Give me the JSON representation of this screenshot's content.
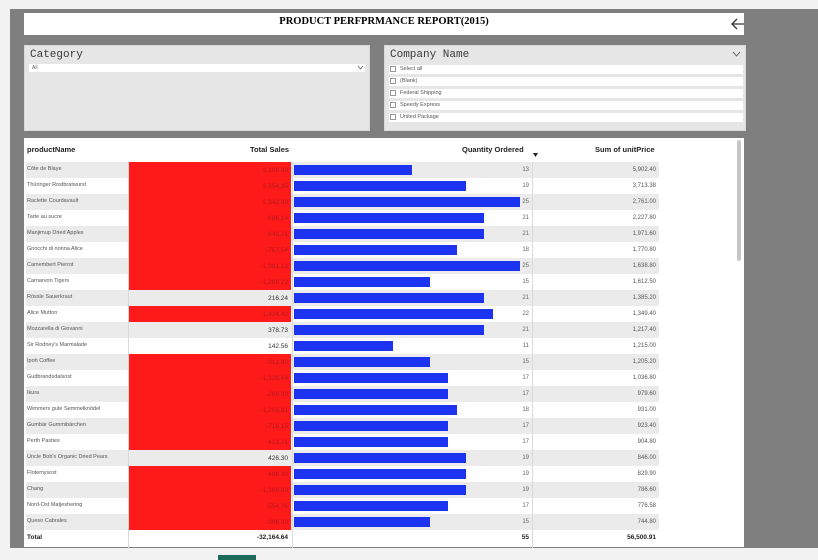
{
  "header": {
    "title": "PRODUCT PERFPRMANCE REPORT(2015)"
  },
  "category_slicer": {
    "title": "Category",
    "selected": "All"
  },
  "company_slicer": {
    "title": "Company Name",
    "options": [
      "Select all",
      "(Blank)",
      "Federal Shipping",
      "Speedy Express",
      "United Package"
    ]
  },
  "table": {
    "columns": {
      "product": "productName",
      "sales": "Total Sales",
      "quantity": "Quantity Ordered",
      "price": "Sum of unitPrice"
    },
    "rows": [
      {
        "name": "Côte de Blaye",
        "sales": "2,108.00",
        "qty": "13",
        "price": "5,902.40",
        "sales_red": 1,
        "qty_frac": 0.52
      },
      {
        "name": "Thüringer Rostbratwurst",
        "sales": "3,654.35",
        "qty": "19",
        "price": "3,713.38",
        "sales_red": 1,
        "qty_frac": 0.76
      },
      {
        "name": "Raclette Courdavault",
        "sales": "2,942.00",
        "qty": "25",
        "price": "2,761.00",
        "sales_red": 1,
        "qty_frac": 1.0
      },
      {
        "name": "Tarte au sucre",
        "sales": "-886.14",
        "qty": "21",
        "price": "2,227.80",
        "sales_red": 1,
        "qty_frac": 0.84
      },
      {
        "name": "Manjimup Dried Apples",
        "sales": "-848.21",
        "qty": "21",
        "price": "1,971.60",
        "sales_red": 1,
        "qty_frac": 0.84
      },
      {
        "name": "Gnocchi di nonna Alice",
        "sales": "-757.54",
        "qty": "18",
        "price": "1,770.80",
        "sales_red": 1,
        "qty_frac": 0.72
      },
      {
        "name": "Camembert Pierrot",
        "sales": "-1,981.13",
        "qty": "25",
        "price": "1,638.80",
        "sales_red": 1,
        "qty_frac": 1.0
      },
      {
        "name": "Carnarvon Tigers",
        "sales": "-1,289.72",
        "qty": "15",
        "price": "1,612.50",
        "sales_red": 1,
        "qty_frac": 0.6
      },
      {
        "name": "Rössle Sauerkraut",
        "sales": "216.24",
        "qty": "21",
        "price": "1,385.20",
        "sales_red": 0,
        "qty_frac": 0.84
      },
      {
        "name": "Alice Mutton",
        "sales": "1,434.42",
        "qty": "22",
        "price": "1,349.40",
        "sales_red": 1,
        "qty_frac": 0.88
      },
      {
        "name": "Mozzarella di Giovanni",
        "sales": "378.73",
        "qty": "21",
        "price": "1,217.40",
        "sales_red": 0,
        "qty_frac": 0.84
      },
      {
        "name": "Sir Rodney's Marmalade",
        "sales": "142.56",
        "qty": "11",
        "price": "1,215.00",
        "sales_red": 0,
        "qty_frac": 0.44
      },
      {
        "name": "Ipoh Coffee",
        "sales": "-312.80",
        "qty": "15",
        "price": "1,205.20",
        "sales_red": 1,
        "qty_frac": 0.6
      },
      {
        "name": "Gudbrandsdalsost",
        "sales": "-1,328.64",
        "qty": "17",
        "price": "1,036.80",
        "sales_red": 1,
        "qty_frac": 0.68
      },
      {
        "name": "Ikura",
        "sales": "-269.00",
        "qty": "17",
        "price": "979.60",
        "sales_red": 1,
        "qty_frac": 0.68
      },
      {
        "name": "Wimmers gute Semmelknödel",
        "sales": "-1,205.81",
        "qty": "18",
        "price": "931.00",
        "sales_red": 1,
        "qty_frac": 0.72
      },
      {
        "name": "Gumbär Gummibärchen",
        "sales": "-716.15",
        "qty": "17",
        "price": "923.40",
        "sales_red": 1,
        "qty_frac": 0.68
      },
      {
        "name": "Perth Pasties",
        "sales": "-413.21",
        "qty": "17",
        "price": "904.80",
        "sales_red": 1,
        "qty_frac": 0.68
      },
      {
        "name": "Uncle Bob's Organic Dried Pears",
        "sales": "426.30",
        "qty": "19",
        "price": "846.00",
        "sales_red": 0,
        "qty_frac": 0.76
      },
      {
        "name": "Flotemysost",
        "sales": "-498.30",
        "qty": "19",
        "price": "829.90",
        "sales_red": 1,
        "qty_frac": 0.76
      },
      {
        "name": "Chang",
        "sales": "-1,369.09",
        "qty": "19",
        "price": "786.60",
        "sales_red": 1,
        "qty_frac": 0.76
      },
      {
        "name": "Nord-Ost Matjeshering",
        "sales": "-554.76",
        "qty": "17",
        "price": "776.58",
        "sales_red": 1,
        "qty_frac": 0.68
      },
      {
        "name": "Queso Cabrales",
        "sales": "-396.00",
        "qty": "15",
        "price": "744.80",
        "sales_red": 1,
        "qty_frac": 0.6
      }
    ],
    "total": {
      "label": "Total",
      "sales": "-32,164.64",
      "qty": "55",
      "price": "56,500.91"
    }
  },
  "colors": {
    "sales_bar": "#ff1a1a",
    "qty_bar": "#1c33f2"
  }
}
